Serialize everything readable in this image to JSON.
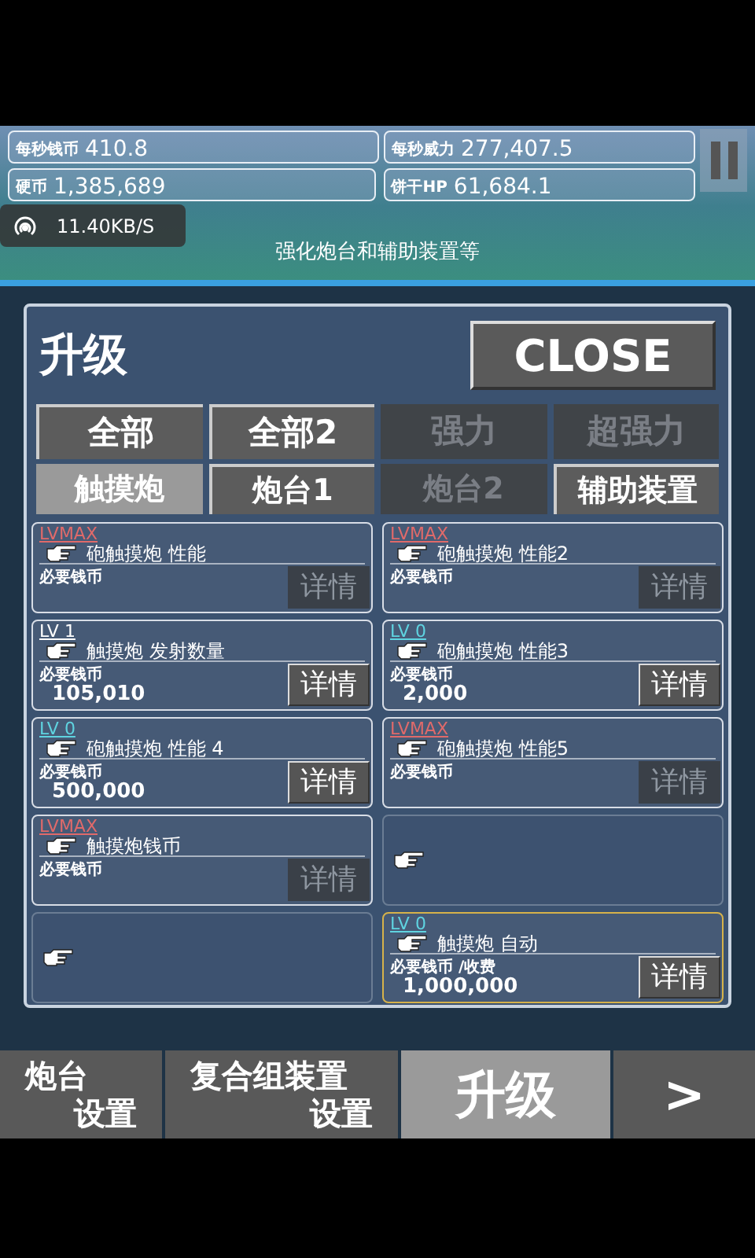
{
  "stats": [
    {
      "label": "每秒钱币",
      "value": "410.8"
    },
    {
      "label": "每秒威力",
      "value": "277,407.5"
    },
    {
      "label": "硬币",
      "value": "1,385,689"
    },
    {
      "label": "饼干HP",
      "value": "61,684.1"
    }
  ],
  "network": {
    "speed": "11.40KB/S"
  },
  "caption": "强化炮台和辅助装置等",
  "panel": {
    "title": "升级",
    "close": "CLOSE",
    "filters": [
      {
        "label": "全部",
        "disabled": false
      },
      {
        "label": "全部2",
        "disabled": false
      },
      {
        "label": "强力",
        "disabled": true
      },
      {
        "label": "超强力",
        "disabled": true
      }
    ],
    "tabs": [
      {
        "label": "触摸炮",
        "selected": true,
        "disabled": false
      },
      {
        "label": "炮台1",
        "selected": false,
        "disabled": false
      },
      {
        "label": "炮台2",
        "selected": false,
        "disabled": true
      },
      {
        "label": "辅助装置",
        "selected": false,
        "disabled": false
      }
    ],
    "cards": [
      {
        "kind": "upgrade",
        "level": "LVMAX",
        "color": "#e06a6a",
        "name": "砲触摸炮 性能",
        "cost_label": "必要钱币",
        "detail": "详情",
        "detail_disabled": true,
        "highlighted": false
      },
      {
        "kind": "upgrade",
        "level": "LVMAX",
        "color": "#e06a6a",
        "name": "砲触摸炮 性能2",
        "cost_label": "必要钱币",
        "detail": "详情",
        "detail_disabled": true,
        "highlighted": false
      },
      {
        "kind": "upgrade",
        "level": "LV 1",
        "color": "#ffffff",
        "name": "触摸炮 发射数量",
        "cost_label": "必要钱币",
        "cost": "105,010",
        "detail": "详情",
        "detail_disabled": false,
        "highlighted": false
      },
      {
        "kind": "upgrade",
        "level": "LV 0",
        "color": "#5fd3e0",
        "name": "砲触摸炮 性能3",
        "cost_label": "必要钱币",
        "cost": "2,000",
        "detail": "详情",
        "detail_disabled": false,
        "highlighted": false
      },
      {
        "kind": "upgrade",
        "level": "LV 0",
        "color": "#5fd3e0",
        "name": "砲触摸炮 性能 4",
        "cost_label": "必要钱币",
        "cost": "500,000",
        "detail": "详情",
        "detail_disabled": false,
        "highlighted": false
      },
      {
        "kind": "upgrade",
        "level": "LVMAX",
        "color": "#e06a6a",
        "name": "砲触摸炮 性能5",
        "cost_label": "必要钱币",
        "detail": "详情",
        "detail_disabled": true,
        "highlighted": false
      },
      {
        "kind": "upgrade",
        "level": "LVMAX",
        "color": "#e06a6a",
        "name": "触摸炮钱币",
        "cost_label": "必要钱币",
        "detail": "详情",
        "detail_disabled": true,
        "highlighted": false
      },
      {
        "kind": "empty"
      },
      {
        "kind": "empty"
      },
      {
        "kind": "upgrade",
        "level": "LV 0",
        "color": "#5fd3e0",
        "name": "触摸炮 自动",
        "cost_label": "必要钱币 /收费",
        "cost": "1,000,000",
        "detail": "详情",
        "detail_disabled": false,
        "highlighted": true
      }
    ]
  },
  "nav": [
    {
      "lines": [
        "炮台",
        "设置"
      ],
      "selected": false
    },
    {
      "lines": [
        "复合组装置",
        "设置"
      ],
      "selected": false
    },
    {
      "lines": [
        "升级"
      ],
      "selected": true
    },
    {
      "lines": [
        ">"
      ],
      "selected": false
    }
  ]
}
